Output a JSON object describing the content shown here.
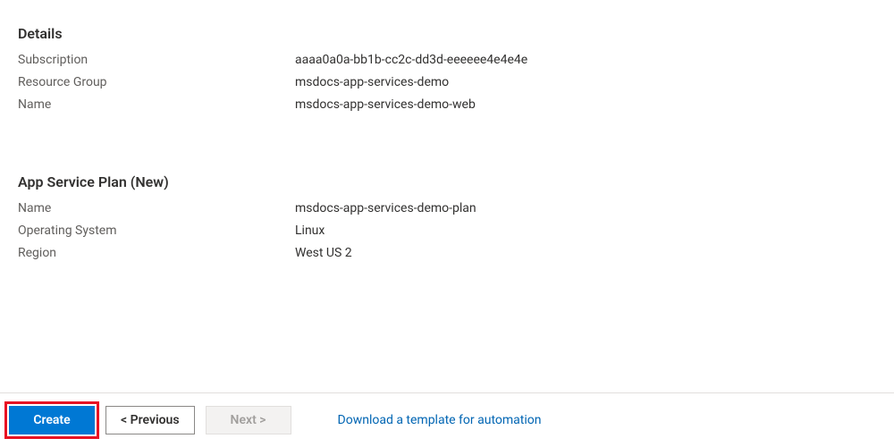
{
  "details": {
    "heading": "Details",
    "rows": [
      {
        "label": "Subscription",
        "value": "aaaa0a0a-bb1b-cc2c-dd3d-eeeeee4e4e4e"
      },
      {
        "label": "Resource Group",
        "value": "msdocs-app-services-demo"
      },
      {
        "label": "Name",
        "value": "msdocs-app-services-demo-web"
      }
    ]
  },
  "appServicePlan": {
    "heading": "App Service Plan (New)",
    "rows": [
      {
        "label": "Name",
        "value": "msdocs-app-services-demo-plan"
      },
      {
        "label": "Operating System",
        "value": "Linux"
      },
      {
        "label": "Region",
        "value": "West US 2"
      }
    ]
  },
  "footer": {
    "create_label": "Create",
    "previous_label": "< Previous",
    "next_label": "Next >",
    "download_link_label": "Download a template for automation"
  }
}
